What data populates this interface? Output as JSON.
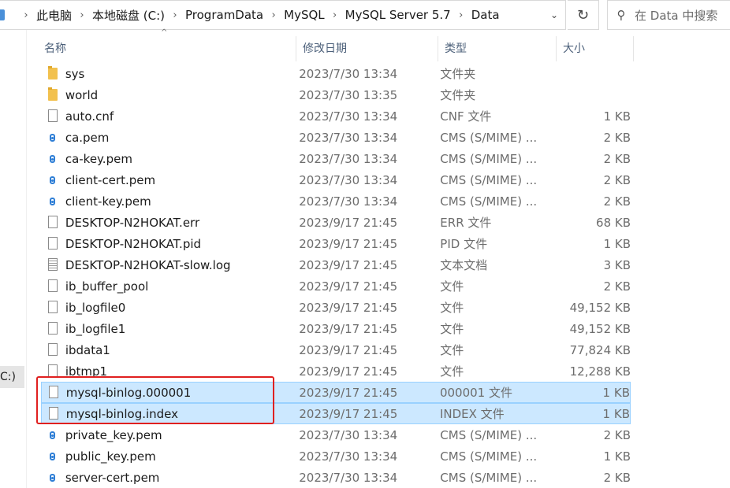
{
  "address": {
    "crumbs": [
      "此电脑",
      "本地磁盘 (C:)",
      "ProgramData",
      "MySQL",
      "MySQL Server 5.7",
      "Data"
    ]
  },
  "search": {
    "placeholder": "在 Data 中搜索"
  },
  "nav": {
    "selected_label": "C:)"
  },
  "columns": {
    "name": "名称",
    "date": "修改日期",
    "type": "类型",
    "size": "大小"
  },
  "files": [
    {
      "name": "sys",
      "date": "2023/7/30 13:34",
      "type": "文件夹",
      "size": "",
      "icon": "folder-icon"
    },
    {
      "name": "world",
      "date": "2023/7/30 13:35",
      "type": "文件夹",
      "size": "",
      "icon": "folder-icon"
    },
    {
      "name": "auto.cnf",
      "date": "2023/7/30 13:34",
      "type": "CNF 文件",
      "size": "1 KB",
      "icon": "file-icon"
    },
    {
      "name": "ca.pem",
      "date": "2023/7/30 13:34",
      "type": "CMS (S/MIME) ...",
      "size": "2 KB",
      "icon": "certificate-icon"
    },
    {
      "name": "ca-key.pem",
      "date": "2023/7/30 13:34",
      "type": "CMS (S/MIME) ...",
      "size": "2 KB",
      "icon": "certificate-icon"
    },
    {
      "name": "client-cert.pem",
      "date": "2023/7/30 13:34",
      "type": "CMS (S/MIME) ...",
      "size": "2 KB",
      "icon": "certificate-icon"
    },
    {
      "name": "client-key.pem",
      "date": "2023/7/30 13:34",
      "type": "CMS (S/MIME) ...",
      "size": "2 KB",
      "icon": "certificate-icon"
    },
    {
      "name": "DESKTOP-N2HOKAT.err",
      "date": "2023/9/17 21:45",
      "type": "ERR 文件",
      "size": "68 KB",
      "icon": "file-icon"
    },
    {
      "name": "DESKTOP-N2HOKAT.pid",
      "date": "2023/9/17 21:45",
      "type": "PID 文件",
      "size": "1 KB",
      "icon": "file-icon"
    },
    {
      "name": "DESKTOP-N2HOKAT-slow.log",
      "date": "2023/9/17 21:45",
      "type": "文本文档",
      "size": "3 KB",
      "icon": "text-file-icon"
    },
    {
      "name": "ib_buffer_pool",
      "date": "2023/9/17 21:45",
      "type": "文件",
      "size": "2 KB",
      "icon": "file-icon"
    },
    {
      "name": "ib_logfile0",
      "date": "2023/9/17 21:45",
      "type": "文件",
      "size": "49,152 KB",
      "icon": "file-icon"
    },
    {
      "name": "ib_logfile1",
      "date": "2023/9/17 21:45",
      "type": "文件",
      "size": "49,152 KB",
      "icon": "file-icon"
    },
    {
      "name": "ibdata1",
      "date": "2023/9/17 21:45",
      "type": "文件",
      "size": "77,824 KB",
      "icon": "file-icon"
    },
    {
      "name": "ibtmp1",
      "date": "2023/9/17 21:45",
      "type": "文件",
      "size": "12,288 KB",
      "icon": "file-icon"
    },
    {
      "name": "mysql-binlog.000001",
      "date": "2023/9/17 21:45",
      "type": "000001 文件",
      "size": "1 KB",
      "icon": "file-icon",
      "selected": true
    },
    {
      "name": "mysql-binlog.index",
      "date": "2023/9/17 21:45",
      "type": "INDEX 文件",
      "size": "1 KB",
      "icon": "file-icon",
      "selected": true
    },
    {
      "name": "private_key.pem",
      "date": "2023/7/30 13:34",
      "type": "CMS (S/MIME) ...",
      "size": "2 KB",
      "icon": "certificate-icon"
    },
    {
      "name": "public_key.pem",
      "date": "2023/7/30 13:34",
      "type": "CMS (S/MIME) ...",
      "size": "1 KB",
      "icon": "certificate-icon"
    },
    {
      "name": "server-cert.pem",
      "date": "2023/7/30 13:34",
      "type": "CMS (S/MIME) ...",
      "size": "2 KB",
      "icon": "certificate-icon"
    }
  ],
  "colors": {
    "selection_bg": "#cce8ff",
    "selection_border": "#99d1ff",
    "annotation_red": "#e02020"
  }
}
